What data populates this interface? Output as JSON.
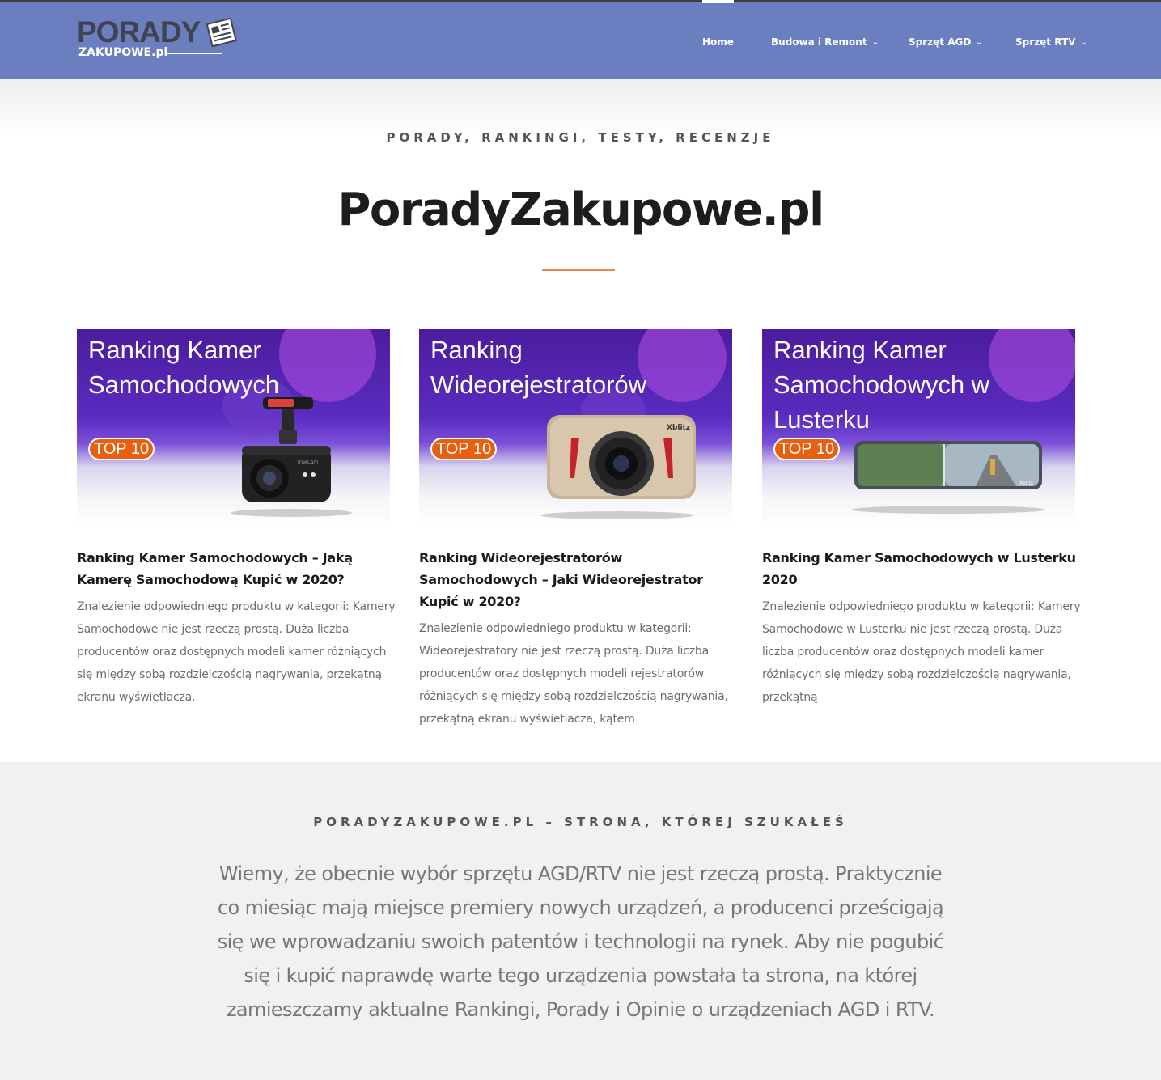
{
  "header": {
    "logo": {
      "top": "PORADY",
      "bottom": "ZAKUPOWE.pl"
    },
    "nav": [
      {
        "label": "Home",
        "active": true,
        "has_dropdown": false
      },
      {
        "label": "Budowa i Remont",
        "active": false,
        "has_dropdown": true
      },
      {
        "label": "Sprzęt AGD",
        "active": false,
        "has_dropdown": true
      },
      {
        "label": "Sprzęt RTV",
        "active": false,
        "has_dropdown": true
      }
    ],
    "chevron_icon": "chevron-down-icon"
  },
  "hero": {
    "tagline": "PORADY, RANKINGI, TESTY, RECENZJE",
    "title": "PoradyZakupowe.pl",
    "separator_color": "#e9864d"
  },
  "cards": [
    {
      "image": {
        "title": "Ranking Kamer Samochodowych",
        "badge": "TOP 10",
        "device_label": "TrueCam",
        "device": "dashcam-icon"
      },
      "title": "Ranking Kamer Samochodowych – Jaką Kamerę Samochodową Kupić w 2020?",
      "excerpt": "Znalezienie odpowiedniego produktu w kategorii: Kamery Samochodowe nie jest rzeczą prostą. Duża liczba producentów oraz dostępnych modeli kamer różniących się między sobą rozdzielczością nagrywania, przekątną ekranu wyświetlacza,"
    },
    {
      "image": {
        "title": "Ranking Wideorejestratorów",
        "badge": "TOP 10",
        "device_label": "Xblitz",
        "device": "video-recorder-icon"
      },
      "title": "Ranking Wideorejestratorów Samochodowych – Jaki Wideorejestrator Kupić w 2020?",
      "excerpt": "Znalezienie odpowiedniego produktu w kategorii: Wideorejestratory nie jest rzeczą prostą. Duża liczba producentów oraz dostępnych modeli rejestratorów różniących się między sobą rozdzielczością nagrywania, przekątną ekranu wyświetlacza, kątem"
    },
    {
      "image": {
        "title": "Ranking Kamer Samochodowych w Lusterku",
        "badge": "TOP 10",
        "device_label": "Xblitz",
        "device": "mirror-camera-icon"
      },
      "title": "Ranking Kamer Samochodowych w Lusterku 2020",
      "excerpt": "Znalezienie odpowiedniego produktu w kategorii: Kamery Samochodowe w Lusterku nie jest rzeczą prostą. Duża liczba producentów oraz dostępnych modeli kamer różniących się między sobą rozdzielczością nagrywania, przekątną"
    }
  ],
  "about": {
    "heading": "PORADYZAKUPOWE.PL – STRONA, KTÓREJ SZUKAŁEŚ",
    "text": "Wiemy, że obecnie wybór sprzętu AGD/RTV nie jest rzeczą prostą. Praktycznie co miesiąc mają miejsce premiery nowych urządzeń, a producenci prześcigają się we wprowadzaniu swoich patentów i technologii na rynek. Aby nie pogubić się i kupić naprawdę warte tego urządzenia powstała ta strona, na której zamieszczamy aktualne Rankingi, Porady i Opinie o urządzeniach AGD i RTV."
  },
  "colors": {
    "header_bg": "#6b7fc0",
    "accent": "#e9864d",
    "badge": "#ea5f0e",
    "about_bg": "#f1f1f1"
  }
}
